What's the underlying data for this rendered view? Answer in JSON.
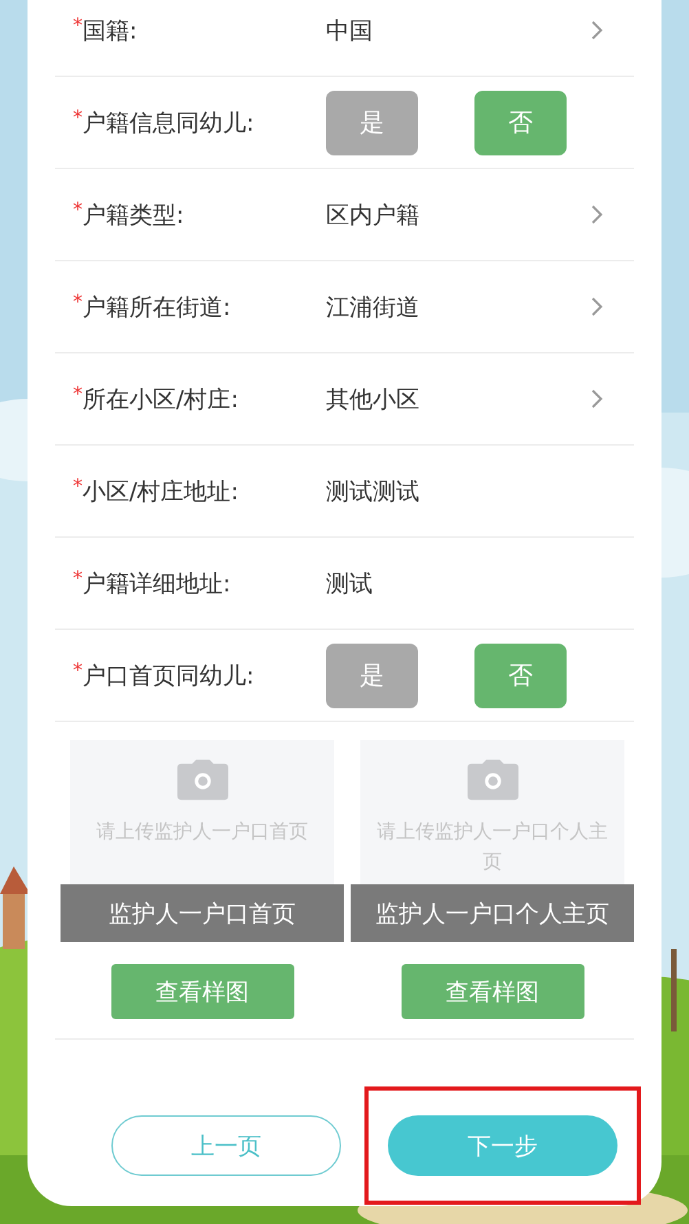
{
  "fields": [
    {
      "kind": "select",
      "mark": "*",
      "label": "国籍:",
      "value": "中国"
    },
    {
      "kind": "toggle",
      "mark": "*",
      "label": "户籍信息同幼儿:",
      "options": [
        {
          "label": "是",
          "selected": false
        },
        {
          "label": "否",
          "selected": true
        }
      ]
    },
    {
      "kind": "select",
      "mark": "*",
      "label": "户籍类型:",
      "value": "区内户籍"
    },
    {
      "kind": "select",
      "mark": "*",
      "label": "户籍所在街道:",
      "value": "江浦街道"
    },
    {
      "kind": "select",
      "mark": "*",
      "label": "所在小区/村庄:",
      "value": "其他小区"
    },
    {
      "kind": "text",
      "mark": "*",
      "label": "小区/村庄地址:",
      "value": "测试测试"
    },
    {
      "kind": "text",
      "mark": "*",
      "label": "户籍详细地址:",
      "value": "测试"
    },
    {
      "kind": "toggle",
      "mark": "*",
      "label": "户口首页同幼儿:",
      "options": [
        {
          "label": "是",
          "selected": false
        },
        {
          "label": "否",
          "selected": true
        }
      ]
    }
  ],
  "uploads": [
    {
      "placeholder": "请上传监护人一户口首页",
      "caption": "监护人一户口首页",
      "sample_button": "查看样图"
    },
    {
      "placeholder": "请上传监护人一户口个人主页",
      "caption": "监护人一户口个人主页",
      "sample_button": "查看样图"
    }
  ],
  "nav": [
    {
      "label": "上一页",
      "kind": "outline",
      "highlighted": false
    },
    {
      "label": "下一步",
      "kind": "primary",
      "highlighted": true
    }
  ]
}
